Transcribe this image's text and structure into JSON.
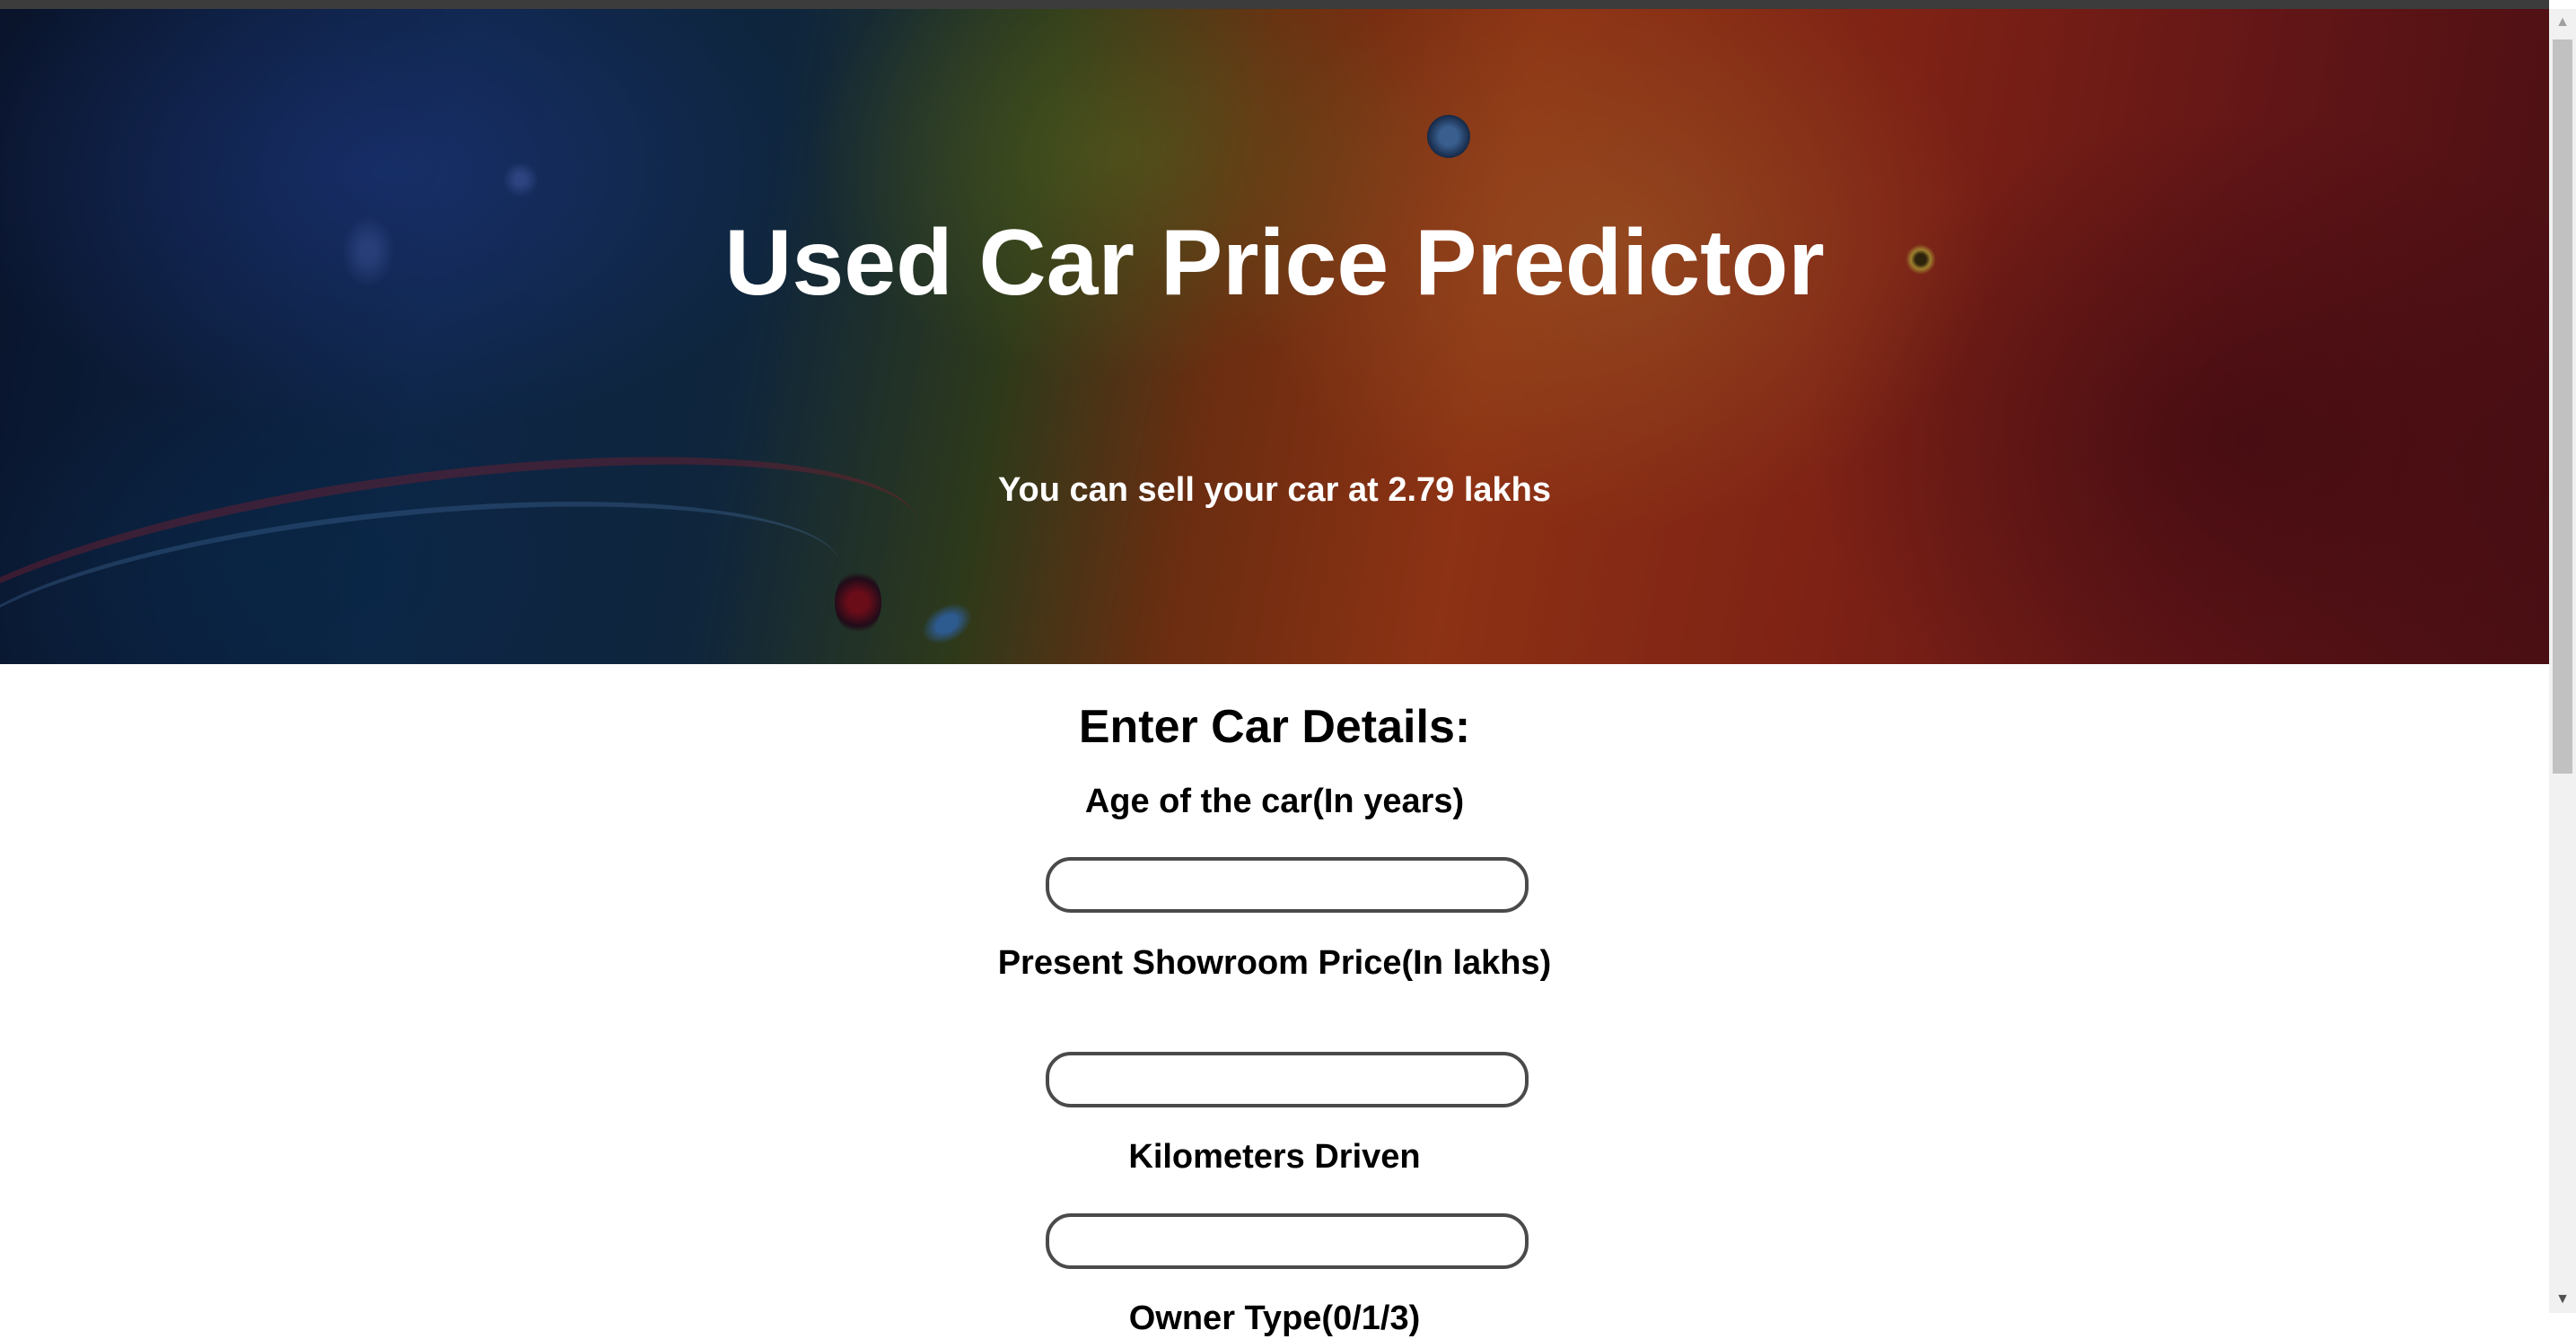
{
  "header": {
    "title": "Used Car Price Predictor",
    "prediction_text": "You can sell your car at 2.79 lakhs"
  },
  "form": {
    "heading": "Enter Car Details:",
    "fields": [
      {
        "label": "Age of the car(In years)",
        "value": ""
      },
      {
        "label": "Present Showroom Price(In lakhs)",
        "value": ""
      },
      {
        "label": "Kilometers Driven",
        "value": ""
      },
      {
        "label": "Owner Type(0/1/3)",
        "value": ""
      }
    ]
  },
  "scrollbar": {
    "up_icon": "▲",
    "down_icon": "▼"
  }
}
